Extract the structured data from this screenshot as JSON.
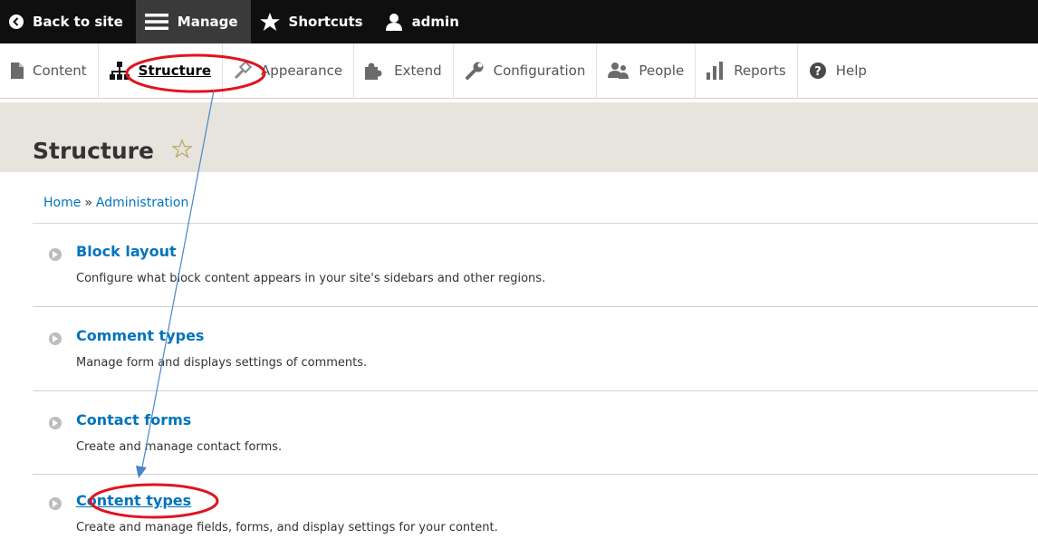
{
  "toolbar": {
    "back": "Back to site",
    "manage": "Manage",
    "shortcuts": "Shortcuts",
    "user": "admin"
  },
  "tray": {
    "items": [
      "Content",
      "Structure",
      "Appearance",
      "Extend",
      "Configuration",
      "People",
      "Reports",
      "Help"
    ],
    "active": "Structure"
  },
  "page": {
    "title": "Structure"
  },
  "breadcrumb": {
    "home": "Home",
    "separator": "»",
    "admin": "Administration"
  },
  "items": [
    {
      "title": "Block layout",
      "description": "Configure what block content appears in your site's sidebars and other regions."
    },
    {
      "title": "Comment types",
      "description": "Manage form and displays settings of comments."
    },
    {
      "title": "Contact forms",
      "description": "Create and manage contact forms."
    },
    {
      "title": "Content types",
      "description": "Create and manage fields, forms, and display settings for your content."
    }
  ],
  "colors": {
    "link": "#0074bd",
    "annotation_red": "#e0141e",
    "annotation_arrow": "#4a86c8"
  }
}
